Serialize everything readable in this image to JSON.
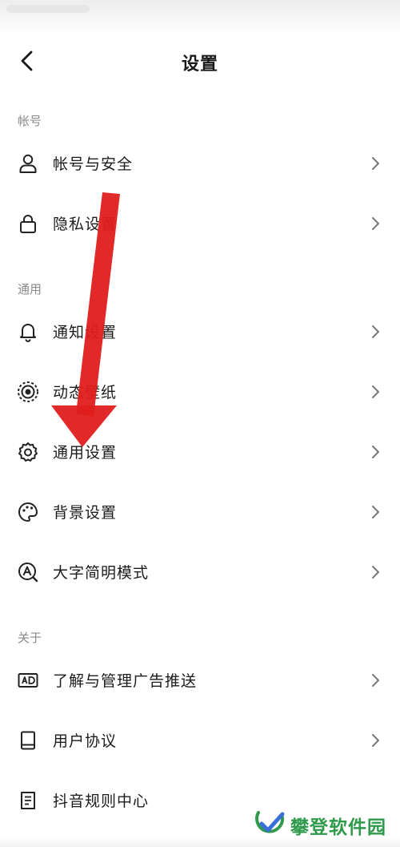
{
  "header": {
    "title": "设置"
  },
  "sections": [
    {
      "label": "帐号",
      "items": [
        {
          "icon": "user-icon",
          "label": "帐号与安全"
        },
        {
          "icon": "lock-icon",
          "label": "隐私设置"
        }
      ]
    },
    {
      "label": "通用",
      "items": [
        {
          "icon": "bell-icon",
          "label": "通知设置"
        },
        {
          "icon": "live-wallpaper-icon",
          "label": "动态壁纸"
        },
        {
          "icon": "gear-icon",
          "label": "通用设置"
        },
        {
          "icon": "palette-icon",
          "label": "背景设置"
        },
        {
          "icon": "large-font-icon",
          "label": "大字简明模式"
        }
      ]
    },
    {
      "label": "关于",
      "items": [
        {
          "icon": "ad-icon",
          "label": "了解与管理广告推送"
        },
        {
          "icon": "book-icon",
          "label": "用户协议"
        },
        {
          "icon": "rules-doc-icon",
          "label": "抖音规则中心"
        }
      ]
    }
  ],
  "annotation": {
    "arrow_color": "#e01e1e",
    "points_to": "通用设置"
  },
  "watermark": {
    "text": "攀登软件园",
    "color": "#2f9a4c"
  }
}
